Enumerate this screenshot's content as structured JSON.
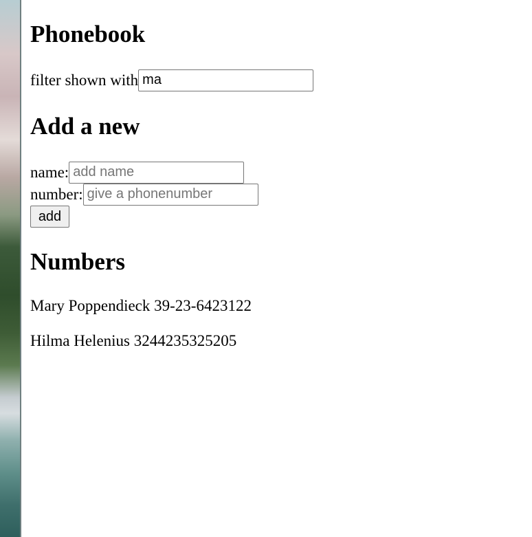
{
  "app": {
    "title": "Phonebook"
  },
  "filter": {
    "label": "filter shown with",
    "value": "ma"
  },
  "add_form": {
    "heading": "Add a new",
    "name_label": "name:",
    "name_placeholder": "add name",
    "number_label": "number:",
    "number_placeholder": "give a phonenumber",
    "submit_label": "add"
  },
  "numbers": {
    "heading": "Numbers",
    "entries": [
      {
        "name": "Mary Poppendieck",
        "number": "39-23-6423122"
      },
      {
        "name": "Hilma Helenius",
        "number": "3244235325205"
      }
    ]
  }
}
